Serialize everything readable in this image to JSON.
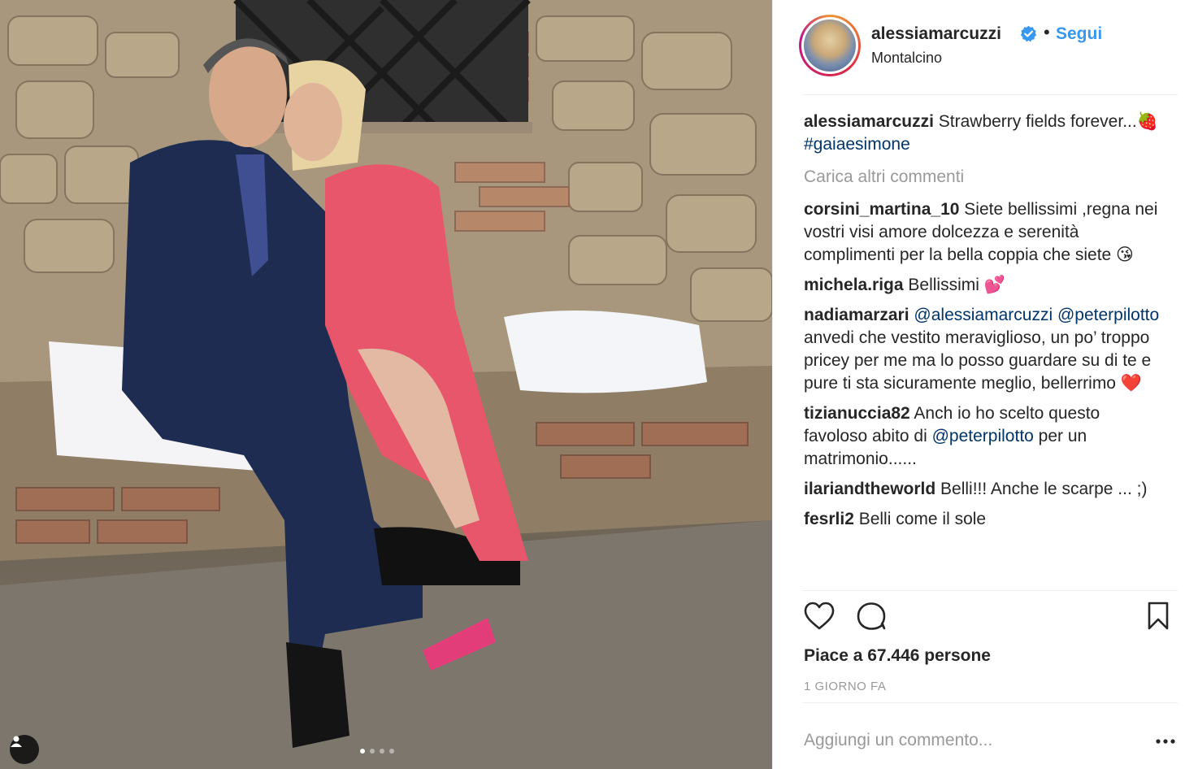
{
  "post": {
    "username": "alessiamarcuzzi",
    "verified_icon": "verified-badge-icon",
    "separator": "•",
    "follow_label": "Segui",
    "location": "Montalcino"
  },
  "caption": {
    "username": "alessiamarcuzzi",
    "text": " Strawberry fields forever...🍓 ",
    "hashtag": "#gaiaesimone"
  },
  "load_more_label": "Carica altri commenti",
  "comments": [
    {
      "username": "corsini_martina_10",
      "text": " Siete bellissimi ,regna nei vostri visi amore dolcezza e serenità complimenti per la bella coppia che siete 😘"
    },
    {
      "username": "michela.riga",
      "text": " Bellissimi 💕"
    },
    {
      "username": "nadiamarzari",
      "mention1": "@alessiamarcuzzi",
      "mention2": "@peterpilotto",
      "text": " anvedi che vestito meraviglioso, un po’ troppo pricey per me ma lo posso guardare su di te e pure ti sta sicuramente meglio, bellerrimo ❤️"
    },
    {
      "username": "tizianuccia82",
      "text_before": " Anch io ho scelto questo favoloso abito di ",
      "mention": "@peterpilotto",
      "text_after": " per un matrimonio......"
    },
    {
      "username": "ilariandtheworld",
      "text": " Belli!!! Anche le scarpe ... ;)"
    },
    {
      "username": "fesrli2",
      "text": " Belli come il sole"
    }
  ],
  "likes_label": "Piace a 67.446 persone",
  "time_label": "1 GIORNO FA",
  "add_comment_placeholder": "Aggiungi un commento...",
  "carousel": {
    "count": 4,
    "active_index": 0
  },
  "colors": {
    "link": "#3897f0",
    "mention": "#003569",
    "muted": "#999999",
    "text": "#262626"
  }
}
